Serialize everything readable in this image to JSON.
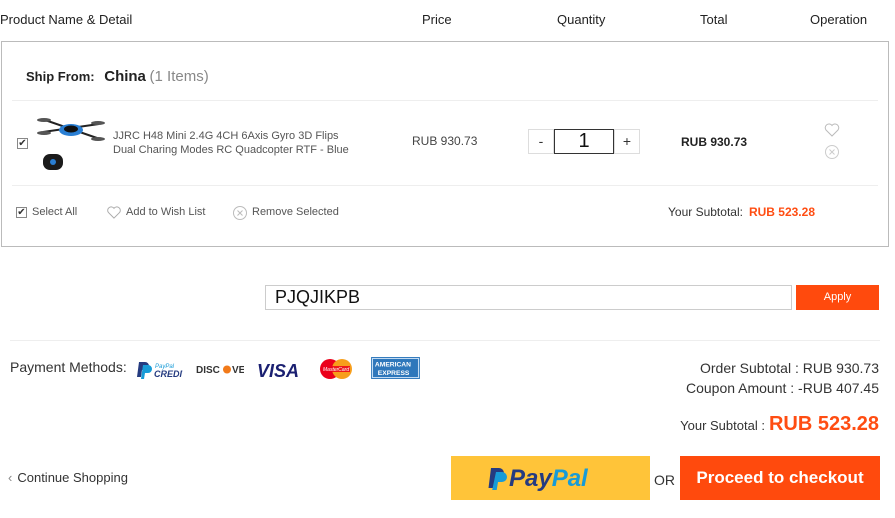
{
  "header": {
    "product_col": "Product Name & Detail",
    "price_col": "Price",
    "quantity_col": "Quantity",
    "total_col": "Total",
    "operation_col": "Operation"
  },
  "cart": {
    "ship_from_label": "Ship From:",
    "country": "China",
    "item_count": "(1 Items)",
    "item": {
      "name": "JJRC H48 Mini 2.4G 4CH 6Axis Gyro 3D Flips Dual Charing Modes RC Quadcopter RTF - Blue",
      "price": "RUB 930.73",
      "quantity": "1",
      "minus": "-",
      "plus": "+",
      "total": "RUB 930.73",
      "checked": true
    },
    "select_all": "Select All",
    "add_to_wishlist": "Add to Wish List",
    "remove_selected": "Remove Selected",
    "subtotal_label": "Your Subtotal:",
    "subtotal_value": "RUB 523.28"
  },
  "coupon": {
    "code": "PJQJIKPB",
    "apply_label": "Apply"
  },
  "payment": {
    "label": "Payment Methods:",
    "methods": [
      "PayPal Credit",
      "Discover",
      "VISA",
      "MasterCard",
      "American Express"
    ]
  },
  "summary": {
    "order_subtotal": "Order Subtotal : RUB 930.73",
    "coupon_amount": "Coupon Amount : -RUB 407.45",
    "your_subtotal_label": "Your Subtotal :",
    "your_subtotal_value": "RUB 523.28"
  },
  "actions": {
    "continue": "Continue Shopping",
    "paypal": "PayPal",
    "or": "OR",
    "checkout": "Proceed to checkout"
  },
  "colors": {
    "accent": "#ff4a0d",
    "paypal_yellow": "#ffc439",
    "paypal_dark": "#253b80",
    "paypal_light": "#179bd7"
  }
}
